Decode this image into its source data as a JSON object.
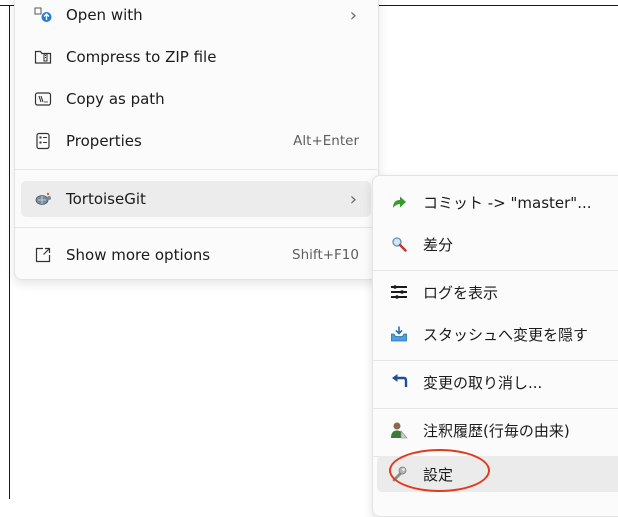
{
  "context_menu": {
    "items": [
      {
        "label": "Open with",
        "icon": "open-with-icon",
        "has_submenu": true
      },
      {
        "label": "Compress to ZIP file",
        "icon": "zip-icon"
      },
      {
        "label": "Copy as path",
        "icon": "copy-path-icon"
      },
      {
        "label": "Properties",
        "icon": "properties-icon",
        "shortcut": "Alt+Enter"
      },
      {
        "label": "TortoiseGit",
        "icon": "tortoisegit-icon",
        "has_submenu": true
      },
      {
        "label": "Show more options",
        "icon": "show-more-icon",
        "shortcut": "Shift+F10"
      }
    ],
    "submenu_arrow": "›"
  },
  "tortoisegit_submenu": {
    "items": [
      {
        "label": "コミット -> \"master\"...",
        "icon": "commit-arrow-icon"
      },
      {
        "label": "差分",
        "icon": "diff-magnifier-icon"
      },
      {
        "label": "ログを表示",
        "icon": "log-icon"
      },
      {
        "label": "スタッシュへ変更を隠す",
        "icon": "stash-icon"
      },
      {
        "label": "変更の取り消し...",
        "icon": "revert-icon"
      },
      {
        "label": "注釈履歴(行毎の由来)",
        "icon": "blame-icon"
      },
      {
        "label": "設定",
        "icon": "settings-wrench-icon"
      }
    ]
  },
  "colors": {
    "annotation": "#e23a1d",
    "menu_bg": "#fbfbfb",
    "hover_bg": "#ececec"
  }
}
